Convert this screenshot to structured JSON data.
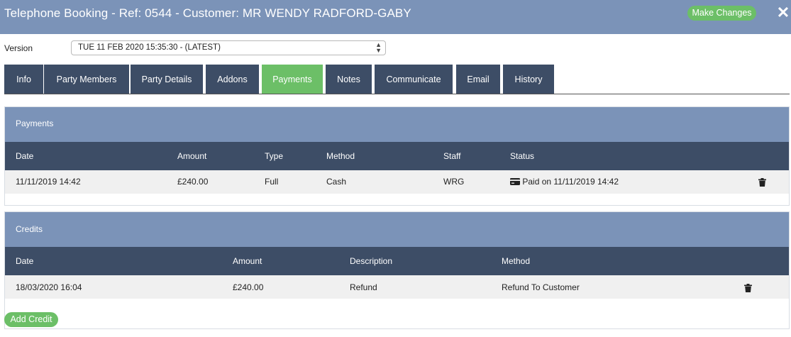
{
  "window": {
    "title": "Telephone Booking - Ref: 0544 - Customer: MR WENDY RADFORD-GABY",
    "make_changes_label": "Make Changes",
    "close_glyph": "✕"
  },
  "version": {
    "label": "Version",
    "selected": "TUE 11 FEB 2020 15:35:30 - (LATEST)"
  },
  "tabs": [
    {
      "label": "Info",
      "active": false
    },
    {
      "label": "Party Members",
      "active": false
    },
    {
      "label": "Party Details",
      "active": false
    },
    {
      "label": "Addons",
      "active": false
    },
    {
      "label": "Payments",
      "active": true
    },
    {
      "label": "Notes",
      "active": false
    },
    {
      "label": "Communicate",
      "active": false
    },
    {
      "label": "Email",
      "active": false
    },
    {
      "label": "History",
      "active": false
    }
  ],
  "payments": {
    "title": "Payments",
    "columns": [
      "Date",
      "Amount",
      "Type",
      "Method",
      "Staff",
      "Status"
    ],
    "rows": [
      {
        "date": "11/11/2019 14:42",
        "amount": "£240.00",
        "type": "Full",
        "method": "Cash",
        "staff": "WRG",
        "status": "Paid on 11/11/2019 14:42",
        "status_icon": "credit-card-icon",
        "action_icon": "trash-icon"
      }
    ]
  },
  "credits": {
    "title": "Credits",
    "columns": [
      "Date",
      "Amount",
      "Description",
      "Method"
    ],
    "rows": [
      {
        "date": "18/03/2020 16:04",
        "amount": "£240.00",
        "description": "Refund",
        "method": "Refund To Customer",
        "action_icon": "trash-icon"
      }
    ],
    "add_label": "Add Credit"
  },
  "colors": {
    "header_blue": "#7b93b8",
    "dark_navy": "#3d4d66",
    "accent_green": "#6cbf67",
    "row_grey": "#f0f0f0"
  }
}
